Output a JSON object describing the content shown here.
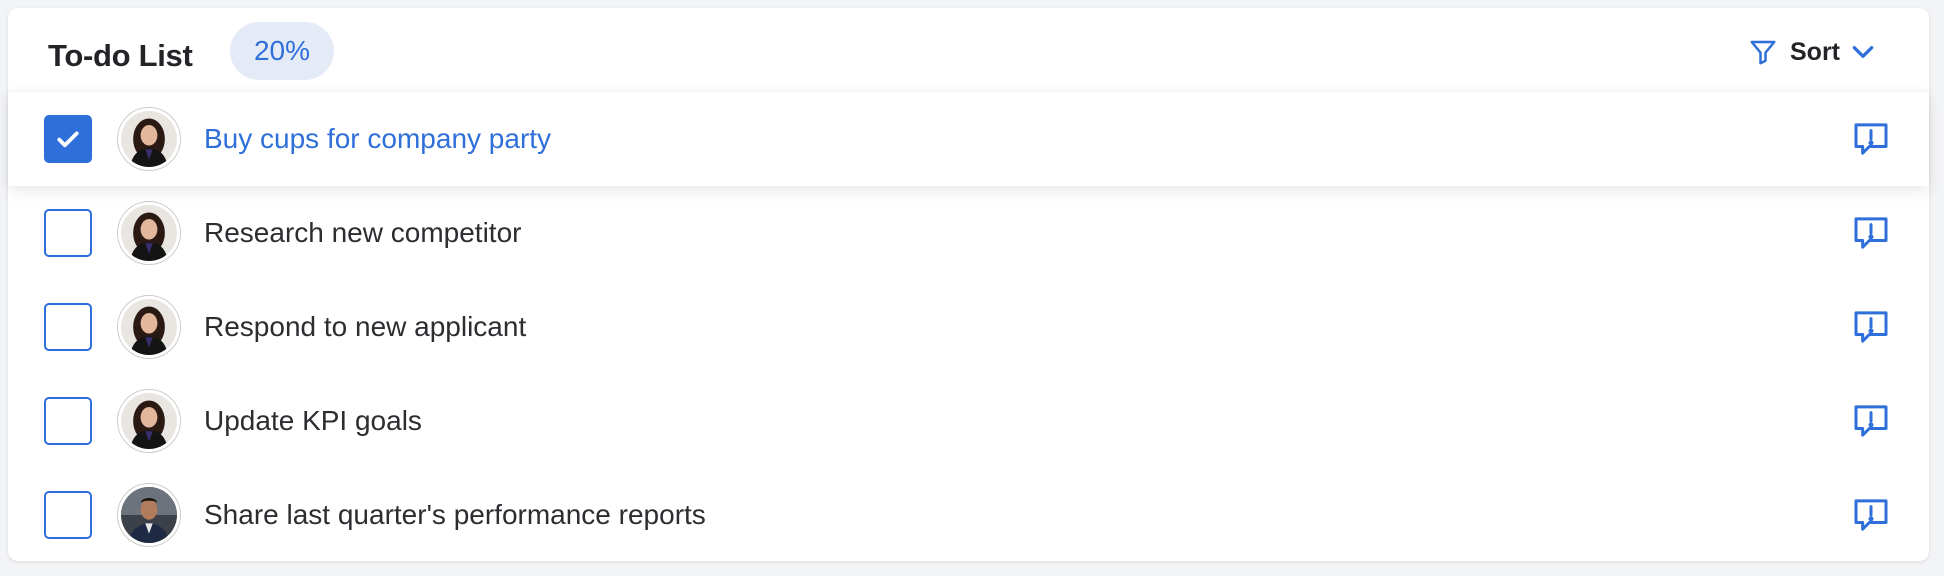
{
  "header": {
    "title": "To-do List",
    "progress_label": "20%",
    "progress_value": 0.2,
    "sort_label": "Sort",
    "filter_icon": "filter-icon",
    "sort_chevron_icon": "chevron-down-icon"
  },
  "colors": {
    "accent": "#2f6fd9",
    "text": "#2b2d31",
    "badge_bg": "#e5ebf6"
  },
  "tasks": [
    {
      "label": "Buy cups for company party",
      "checked": true,
      "avatar": "woman-avatar",
      "comment_icon": "comment-alert-icon"
    },
    {
      "label": "Research new competitor",
      "checked": false,
      "avatar": "woman-avatar",
      "comment_icon": "comment-alert-icon"
    },
    {
      "label": "Respond to new applicant",
      "checked": false,
      "avatar": "woman-avatar",
      "comment_icon": "comment-alert-icon"
    },
    {
      "label": "Update KPI goals",
      "checked": false,
      "avatar": "woman-avatar",
      "comment_icon": "comment-alert-icon"
    },
    {
      "label": "Share last quarter's performance reports",
      "checked": false,
      "avatar": "man-avatar",
      "comment_icon": "comment-alert-icon"
    }
  ]
}
